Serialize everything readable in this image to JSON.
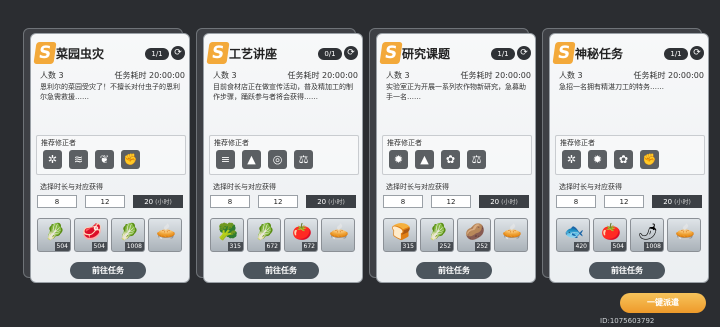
{
  "cards": [
    {
      "title": "菜园虫灾",
      "count": "1/1",
      "people": "人数 3",
      "time": "任务耗时 20:00:00",
      "desc": "恩利尔的菜园受灾了！不擅长对付虫子的恩利尔急需救援……",
      "rec_label": "推荐修正者",
      "rec_icons": [
        "claw-icon",
        "wind-icon",
        "leaf-icon",
        "fist-icon"
      ],
      "dur_label": "选择时长与对应获得",
      "durations": [
        "8",
        "12",
        "20"
      ],
      "unit": "(小时)",
      "items": [
        {
          "name": "bok-choy-item",
          "glyph": "🥬",
          "qty": "504"
        },
        {
          "name": "meat-item",
          "glyph": "🥩",
          "qty": "504"
        },
        {
          "name": "scallion-item",
          "glyph": "🥬",
          "qty": "1008"
        },
        {
          "name": "pie-item",
          "glyph": "🥧",
          "qty": ""
        }
      ],
      "go_label": "前往任务"
    },
    {
      "title": "工艺讲座",
      "count": "0/1",
      "people": "人数 3",
      "time": "任务耗时 20:00:00",
      "desc": "目前食材店正在做宣传活动，普及精加工的制作步骤，踊跃参与者将会获得……",
      "rec_label": "推荐修正者",
      "rec_icons": [
        "layers-icon",
        "triangle-icon",
        "wave-icon",
        "balance-icon"
      ],
      "dur_label": "选择时长与对应获得",
      "durations": [
        "8",
        "12",
        "20"
      ],
      "unit": "(小时)",
      "items": [
        {
          "name": "cauliflower-item",
          "glyph": "🥦",
          "qty": "315"
        },
        {
          "name": "scallion-item",
          "glyph": "🥬",
          "qty": "672"
        },
        {
          "name": "tomato-item",
          "glyph": "🍅",
          "qty": "672"
        },
        {
          "name": "pie-item",
          "glyph": "🥧",
          "qty": ""
        }
      ],
      "go_label": "前往任务"
    },
    {
      "title": "研究课题",
      "count": "1/1",
      "people": "人数 3",
      "time": "任务耗时 20:00:00",
      "desc": "实验室正为开展一系列农作物新研究，急募助手一名……",
      "rec_label": "推荐修正者",
      "rec_icons": [
        "sun-icon",
        "triangle-icon",
        "flower-icon",
        "balance-icon"
      ],
      "dur_label": "选择时长与对应获得",
      "durations": [
        "8",
        "12",
        "20"
      ],
      "unit": "(小时)",
      "items": [
        {
          "name": "bread-item",
          "glyph": "🍞",
          "qty": "315"
        },
        {
          "name": "bok-choy-item",
          "glyph": "🥬",
          "qty": "252"
        },
        {
          "name": "potato-item",
          "glyph": "🥔",
          "qty": "252"
        },
        {
          "name": "pie-item",
          "glyph": "🥧",
          "qty": ""
        }
      ],
      "go_label": "前往任务"
    },
    {
      "title": "神秘任务",
      "count": "1/1",
      "people": "人数 3",
      "time": "任务耗时 20:00:00",
      "desc": "急招一名拥有精湛刀工的特务……",
      "rec_label": "推荐修正者",
      "rec_icons": [
        "claw-icon",
        "sun-icon",
        "flower-icon",
        "fist-icon"
      ],
      "dur_label": "选择时长与对应获得",
      "durations": [
        "8",
        "12",
        "20"
      ],
      "unit": "(小时)",
      "items": [
        {
          "name": "salmon-item",
          "glyph": "🐟",
          "qty": "420"
        },
        {
          "name": "tomato-item",
          "glyph": "🍅",
          "qty": "504"
        },
        {
          "name": "chili-item",
          "glyph": "🌶",
          "qty": "1008"
        },
        {
          "name": "pie-item",
          "glyph": "🥧",
          "qty": ""
        }
      ],
      "go_label": "前往任务"
    }
  ],
  "dispatch_label": "一键派遣",
  "footer_id": "ID:1075603792"
}
